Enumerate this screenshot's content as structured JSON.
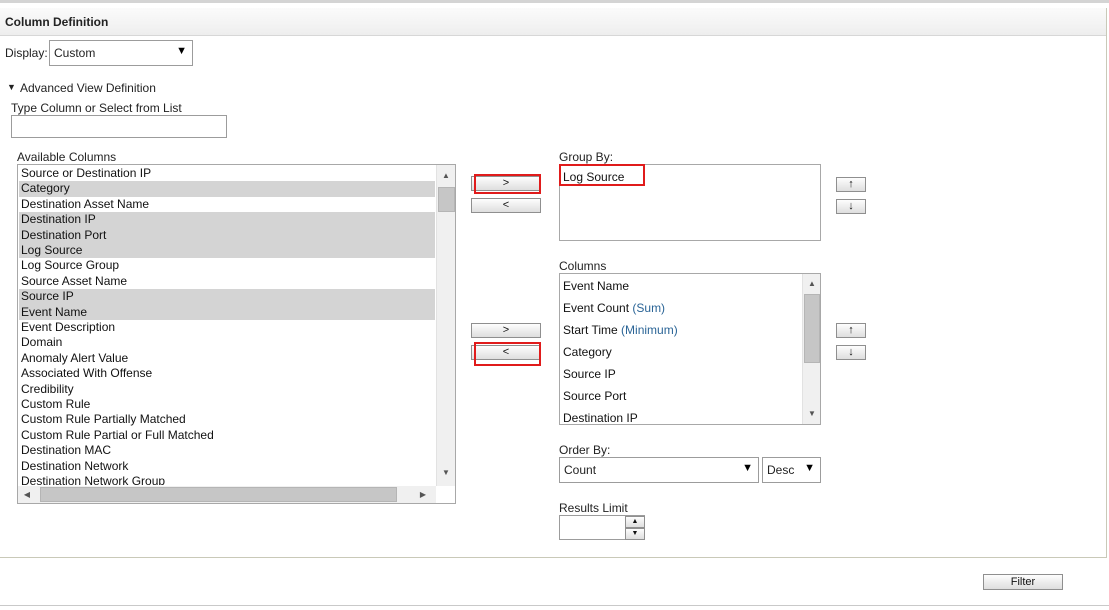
{
  "panel": {
    "title": "Column Definition"
  },
  "display": {
    "label": "Display:",
    "value": "Custom"
  },
  "advanced": {
    "toggle_label": "Advanced View Definition",
    "type_label": "Type Column or Select from List",
    "type_value": ""
  },
  "available": {
    "label": "Available Columns",
    "items": [
      {
        "label": "Source or Destination IP",
        "selected": false
      },
      {
        "label": "Category",
        "selected": true
      },
      {
        "label": "Destination Asset Name",
        "selected": false
      },
      {
        "label": "Destination IP",
        "selected": true
      },
      {
        "label": "Destination Port",
        "selected": true
      },
      {
        "label": "Log Source",
        "selected": true
      },
      {
        "label": "Log Source Group",
        "selected": false
      },
      {
        "label": "Source Asset Name",
        "selected": false
      },
      {
        "label": "Source IP",
        "selected": true
      },
      {
        "label": "Event Name",
        "selected": true
      },
      {
        "label": "Event Description",
        "selected": false
      },
      {
        "label": "Domain",
        "selected": false
      },
      {
        "label": "Anomaly Alert Value",
        "selected": false
      },
      {
        "label": "Associated With Offense",
        "selected": false
      },
      {
        "label": "Credibility",
        "selected": false
      },
      {
        "label": "Custom Rule",
        "selected": false
      },
      {
        "label": "Custom Rule Partially Matched",
        "selected": false
      },
      {
        "label": "Custom Rule Partial or Full Matched",
        "selected": false
      },
      {
        "label": "Destination MAC",
        "selected": false
      },
      {
        "label": "Destination Network",
        "selected": false
      },
      {
        "label": "Destination Network Group",
        "selected": false
      }
    ]
  },
  "group_by": {
    "label": "Group By:",
    "items": [
      "Log Source"
    ]
  },
  "columns": {
    "label": "Columns",
    "items": [
      {
        "label": "Event Name",
        "agg": ""
      },
      {
        "label": "Event Count",
        "agg": "(Sum)"
      },
      {
        "label": "Start Time",
        "agg": "(Minimum)"
      },
      {
        "label": "Category",
        "agg": ""
      },
      {
        "label": "Source IP",
        "agg": ""
      },
      {
        "label": "Source Port",
        "agg": ""
      },
      {
        "label": "Destination IP",
        "agg": ""
      }
    ]
  },
  "transfer": {
    "add_label": ">",
    "remove_label": "<"
  },
  "order": {
    "up_label": "↑",
    "down_label": "↓"
  },
  "order_by": {
    "label": "Order By:",
    "field": "Count",
    "direction": "Desc"
  },
  "results_limit": {
    "label": "Results Limit",
    "value": ""
  },
  "filter_button": {
    "label": "Filter"
  },
  "icons": {
    "expand": "triangle-down-icon",
    "dropdown": "dropdown-arrow-icon"
  }
}
